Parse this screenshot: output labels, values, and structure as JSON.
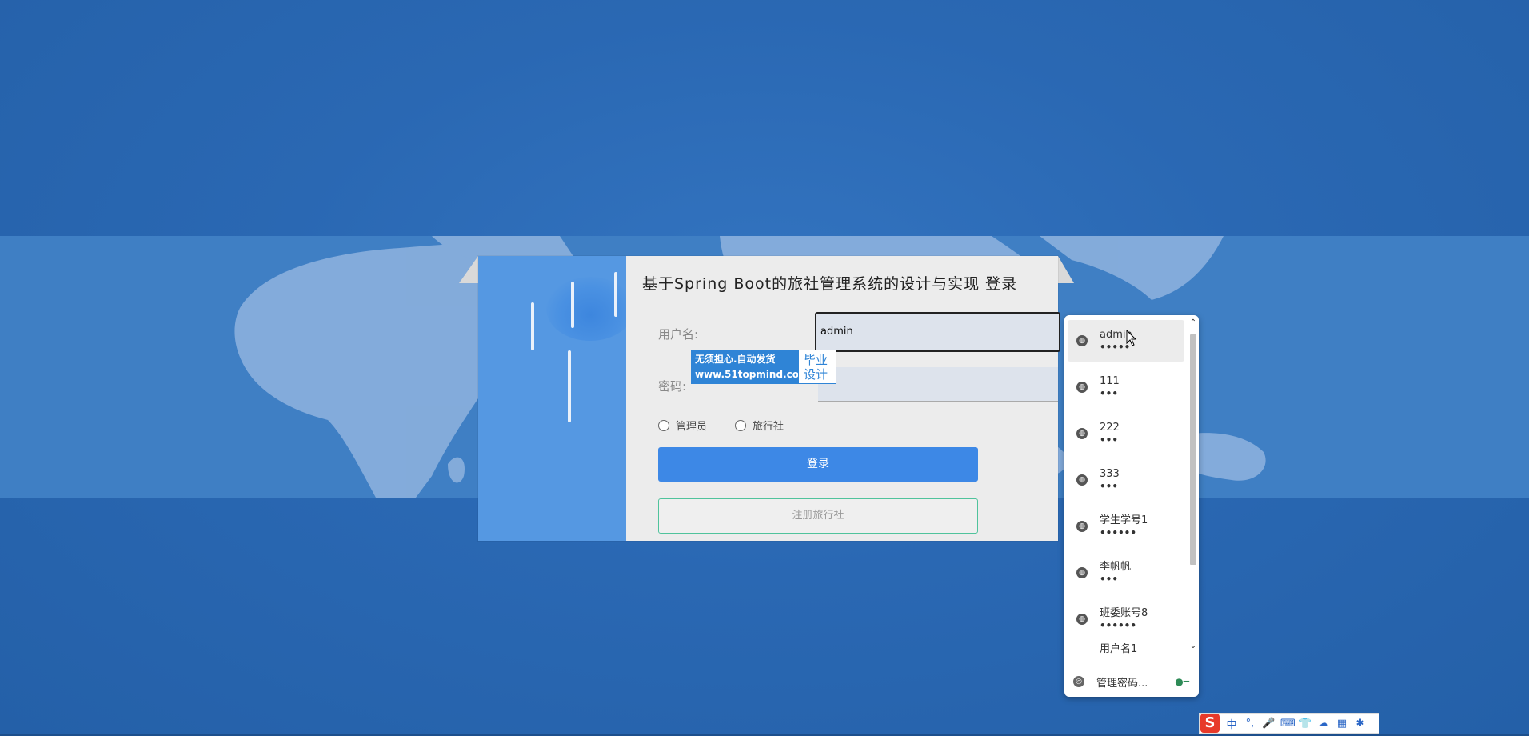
{
  "page": {
    "title": "基于Spring Boot的旅社管理系统的设计与实现 登录"
  },
  "form": {
    "username_label": "用户名:",
    "username_value": "admin",
    "password_label": "密码:",
    "roles": [
      "管理员",
      "旅行社"
    ],
    "login_label": "登录",
    "register_label": "注册旅行社"
  },
  "ad": {
    "line1": "无须担心.自动发货",
    "line2": "www.51topmind.com",
    "badge_line1": "毕业",
    "badge_line2": "设计"
  },
  "password_popup": {
    "items": [
      {
        "user": "admin",
        "mask": "•••••"
      },
      {
        "user": "111",
        "mask": "•••"
      },
      {
        "user": "222",
        "mask": "•••"
      },
      {
        "user": "333",
        "mask": "•••"
      },
      {
        "user": "学生学号1",
        "mask": "••••••"
      },
      {
        "user": "李帆帆",
        "mask": "•••"
      },
      {
        "user": "班委账号8",
        "mask": "••••••"
      },
      {
        "user": "用户名1",
        "mask": ""
      }
    ],
    "manage_label": "管理密码...",
    "icons": {
      "item": "globe-icon",
      "manage": "chrome-icon",
      "key": "key-icon"
    }
  },
  "ime": {
    "logo": "S",
    "items": [
      "中",
      "°,",
      "🎤",
      "⌨",
      "👕",
      "☁",
      "▦",
      "✱"
    ]
  },
  "colors": {
    "background": "#2a68b3",
    "card_left": "#5598e2",
    "login_button": "#3d88e6",
    "register_border": "#4fc39c"
  }
}
